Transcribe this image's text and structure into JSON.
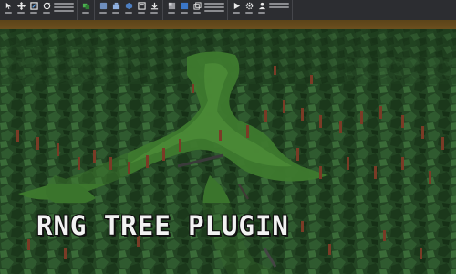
{
  "app": {
    "ribbon_groups": [
      {
        "name": "tools",
        "icons": [
          "select-icon",
          "move-icon",
          "scale-icon",
          "rotate-icon",
          "transform-icon"
        ]
      },
      {
        "name": "collisions",
        "icons": [
          "join-icon"
        ]
      },
      {
        "name": "terrain",
        "icons": [
          "editor-icon",
          "toolbox-icon",
          "part-icon",
          "ui-icon",
          "import-icon"
        ]
      },
      {
        "name": "insert",
        "icons": [
          "material-icon",
          "color-icon",
          "group-icon",
          "lock-icon",
          "anchor-icon"
        ]
      },
      {
        "name": "test",
        "icons": [
          "play-icon",
          "settings-icon",
          "team-icon"
        ]
      }
    ],
    "colors": {
      "ribbon": "#2c2d31",
      "grass": "#3d6e2b",
      "foliage_dark": "#1f3d1f",
      "foliage_light": "#2f5a2f",
      "trunk": "#7a3b26",
      "sky": "#6b4a1e"
    }
  },
  "overlay": {
    "title": "RNG TREE PLUGIN"
  }
}
